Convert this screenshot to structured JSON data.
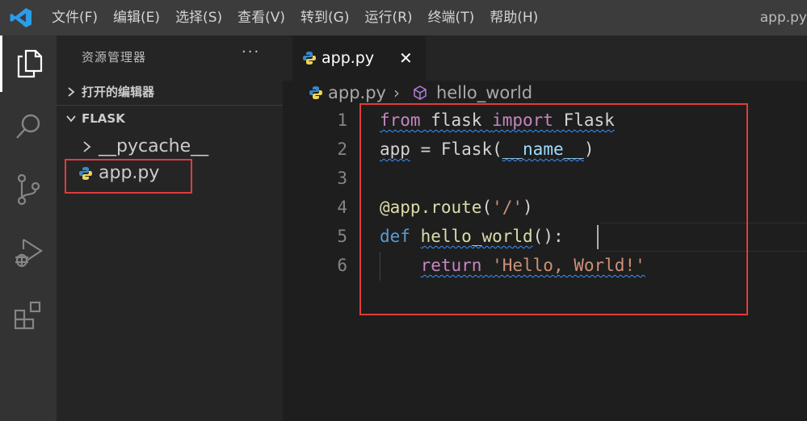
{
  "menu": {
    "items": [
      "文件(F)",
      "编辑(E)",
      "选择(S)",
      "查看(V)",
      "转到(G)",
      "运行(R)",
      "终端(T)",
      "帮助(H)"
    ],
    "window_title": "app.py"
  },
  "activity_bar": {
    "icons": [
      "explorer-icon",
      "search-icon",
      "source-control-icon",
      "run-debug-icon",
      "extensions-icon"
    ]
  },
  "sidebar": {
    "title": "资源管理器",
    "more": "···",
    "open_editors_label": "打开的编辑器",
    "folder_label": "FLASK",
    "tree": [
      {
        "label": "__pycache__",
        "type": "folder"
      },
      {
        "label": "app.py",
        "type": "python-file"
      }
    ]
  },
  "tab": {
    "label": "app.py",
    "close": "✕"
  },
  "breadcrumbs": {
    "file": "app.py",
    "separator": "›",
    "symbol": "hello_world"
  },
  "code": {
    "line_numbers": [
      "1",
      "2",
      "3",
      "4",
      "5",
      "6"
    ],
    "l1": {
      "t1": "from",
      "t2": " flask ",
      "t3": "import",
      "t4": " Flask"
    },
    "l2": {
      "t1": "app",
      "t2": " = ",
      "t3": "Flask",
      "t4": "(",
      "t5": "__name__",
      "t6": ")"
    },
    "l4": {
      "t1": "@app.route",
      "t2": "(",
      "t3": "'/'",
      "t4": ")"
    },
    "l5": {
      "t1": "def",
      "t2": " ",
      "t3": "hello_world",
      "t4": "():"
    },
    "l6": {
      "t1": "    ",
      "t2": "return",
      "t3": " ",
      "t4": "'Hello, World!'"
    }
  },
  "colors": {
    "keyword_control": "#c586c0",
    "keyword_storage": "#569cd6",
    "function": "#dcdcaa",
    "variable": "#9cdcfe",
    "string": "#ce9178",
    "highlight_box": "#e03c3c",
    "python_blue": "#3b86c6",
    "python_yellow": "#f0d458"
  }
}
